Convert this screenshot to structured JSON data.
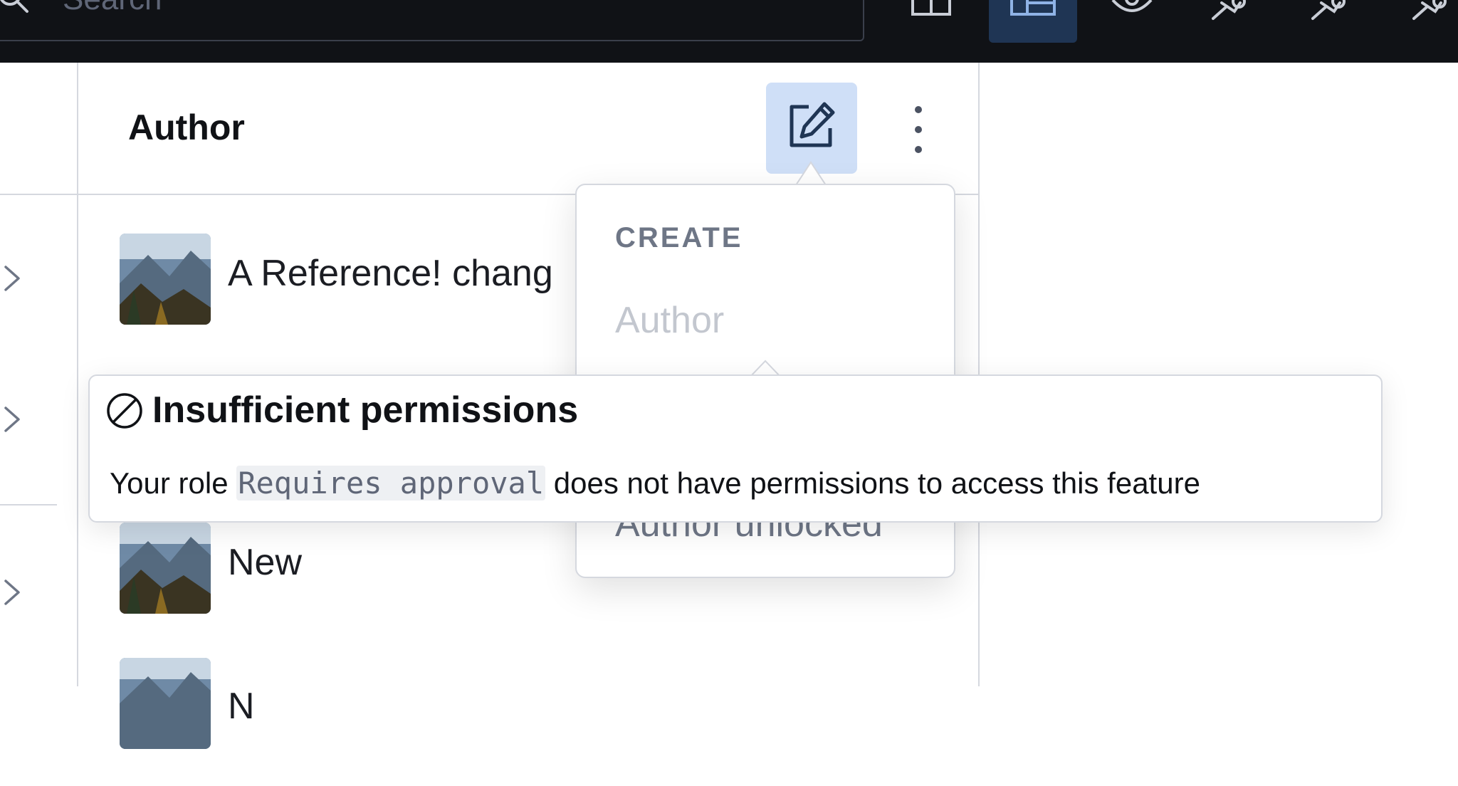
{
  "search": {
    "placeholder": "Search"
  },
  "panel": {
    "title": "Author",
    "items": [
      {
        "label": "A Reference! chang"
      },
      {
        "label": "New"
      },
      {
        "label": "N"
      }
    ]
  },
  "popover": {
    "section_label": "CREATE",
    "items": [
      {
        "label": "Author",
        "disabled": true
      },
      {
        "label": "Author unlocked"
      }
    ]
  },
  "tooltip": {
    "title": "Insufficient permissions",
    "message_prefix": "Your role ",
    "role_name": "Requires approval",
    "message_suffix": " does not have permissions to access this feature"
  },
  "colors": {
    "topbar_bg": "#101216",
    "active_tool_bg": "#1f3554",
    "edit_button_bg": "#cfdff7",
    "icon_blue": "#1f3554"
  }
}
